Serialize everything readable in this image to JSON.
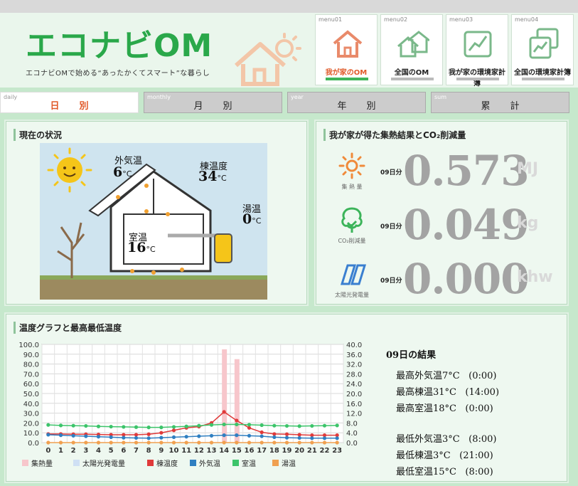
{
  "logo": {
    "title": "エコナビOM",
    "subtitle": "エコナビOMで始める“あったかくてスマート”な暮らし"
  },
  "menus": [
    {
      "code": "menu01",
      "label": "我が家のOM",
      "icon": "house-icon",
      "active": true
    },
    {
      "code": "menu02",
      "label": "全国のOM",
      "icon": "houses-icon",
      "active": false
    },
    {
      "code": "menu03",
      "label": "我が家の環境家計簿",
      "icon": "chart-book-icon",
      "active": false
    },
    {
      "code": "menu04",
      "label": "全国の環境家計簿",
      "icon": "chart-books-icon",
      "active": false
    }
  ],
  "tabs": [
    {
      "code": "daily",
      "label": "日別",
      "active": true
    },
    {
      "code": "monthly",
      "label": "月別",
      "active": false
    },
    {
      "code": "year",
      "label": "年別",
      "active": false
    },
    {
      "code": "sum",
      "label": "累計",
      "active": false
    }
  ],
  "status": {
    "title": "現在の状況",
    "outside": {
      "label": "外気温",
      "value": "6",
      "unit": "°C"
    },
    "ridge": {
      "label": "棟温度",
      "value": "34",
      "unit": "°C"
    },
    "water": {
      "label": "湯温",
      "value": "0",
      "unit": "°C"
    },
    "room": {
      "label": "室温",
      "value": "16",
      "unit": "°C"
    }
  },
  "results_panel": {
    "title": "我が家が得た集熱結果とCO₂削減量",
    "rows": [
      {
        "caption": "集 熱 量",
        "day": "09日分",
        "value": "0.573",
        "unit": "MJ",
        "icon": "sun-icon"
      },
      {
        "caption": "CO₂削減量",
        "day": "09日分",
        "value": "0.049",
        "unit": "kg",
        "icon": "tree-icon"
      },
      {
        "caption": "太陽光発電量",
        "day": "09日分",
        "value": "0.000",
        "unit": "khw",
        "icon": "solar-panel-icon"
      }
    ]
  },
  "graph_panel": {
    "title": "温度グラフと最高最低温度"
  },
  "day_results": {
    "title": "09日の結果",
    "max": [
      {
        "label": "最高外気温",
        "value": "7°C",
        "time": "(0:00)"
      },
      {
        "label": "最高棟温",
        "value": "31°C",
        "time": "(14:00)"
      },
      {
        "label": "最高室温",
        "value": "18°C",
        "time": "(0:00)"
      }
    ],
    "min": [
      {
        "label": "最低外気温",
        "value": "3°C",
        "time": "(8:00)"
      },
      {
        "label": "最低棟温",
        "value": "3°C",
        "time": "(21:00)"
      },
      {
        "label": "最低室温",
        "value": "15°C",
        "time": "(8:00)"
      }
    ]
  },
  "chart_data": {
    "type": "line",
    "x": [
      0,
      1,
      2,
      3,
      4,
      5,
      6,
      7,
      8,
      9,
      10,
      11,
      12,
      13,
      14,
      15,
      16,
      17,
      18,
      19,
      20,
      21,
      22,
      23
    ],
    "y_left_range": [
      0,
      100
    ],
    "y_left_ticks": [
      "0.0",
      "10.0",
      "20.0",
      "30.0",
      "40.0",
      "50.0",
      "60.0",
      "70.0",
      "80.0",
      "90.0",
      "100.0"
    ],
    "y_right_range": [
      0,
      40
    ],
    "y_right_ticks": [
      "0.0",
      "4.0",
      "8.0",
      "12.0",
      "16.0",
      "20.0",
      "24.0",
      "28.0",
      "32.0",
      "36.0",
      "40.0"
    ],
    "bars": [
      {
        "name": "集熱量",
        "color": "#f7c6cb",
        "axis": "left",
        "values": [
          0,
          0,
          0,
          0,
          0,
          0,
          0,
          0,
          0,
          0,
          0,
          0,
          0,
          0,
          95,
          85,
          0,
          0,
          0,
          0,
          0,
          0,
          0,
          0
        ]
      },
      {
        "name": "太陽光発電量",
        "color": "#cfe0f4",
        "axis": "left",
        "values": [
          0,
          0,
          0,
          0,
          0,
          0,
          0,
          0,
          0,
          0,
          0,
          0,
          0,
          0,
          0,
          0,
          0,
          0,
          0,
          0,
          0,
          0,
          0,
          0
        ]
      }
    ],
    "series": [
      {
        "name": "棟温度",
        "color": "#e03a3a",
        "axis": "right",
        "values": [
          3.5,
          3.5,
          3.4,
          3.4,
          3.3,
          3.2,
          3.2,
          3.2,
          3.4,
          4,
          5,
          6,
          6.5,
          8,
          12.5,
          9,
          6,
          4.2,
          3.5,
          3.4,
          3.2,
          3.0,
          3.0,
          3.0
        ]
      },
      {
        "name": "外気温",
        "color": "#2f7fc1",
        "axis": "right",
        "values": [
          3.2,
          3,
          2.8,
          2.6,
          2.4,
          2.2,
          2.0,
          1.9,
          1.8,
          2.0,
          2.2,
          2.4,
          2.6,
          2.8,
          3.0,
          3.0,
          2.8,
          2.6,
          2.2,
          2.0,
          1.9,
          1.8,
          1.8,
          1.8
        ]
      },
      {
        "name": "室温",
        "color": "#3cc46a",
        "axis": "right",
        "values": [
          7.2,
          7.0,
          6.9,
          6.8,
          6.6,
          6.5,
          6.4,
          6.3,
          6.2,
          6.2,
          6.4,
          6.6,
          6.9,
          7.2,
          7.4,
          7.4,
          7.3,
          7.1,
          6.9,
          6.8,
          6.7,
          6.8,
          6.9,
          7.0
        ]
      },
      {
        "name": "湯温",
        "color": "#f0a050",
        "axis": "right",
        "values": [
          0,
          0,
          0,
          0,
          0,
          0,
          0,
          0,
          0,
          0,
          0,
          0,
          0,
          0,
          0,
          0,
          0,
          0,
          0,
          0,
          0,
          0,
          0,
          0
        ]
      }
    ],
    "legend_position": "bottom",
    "grid": true
  }
}
